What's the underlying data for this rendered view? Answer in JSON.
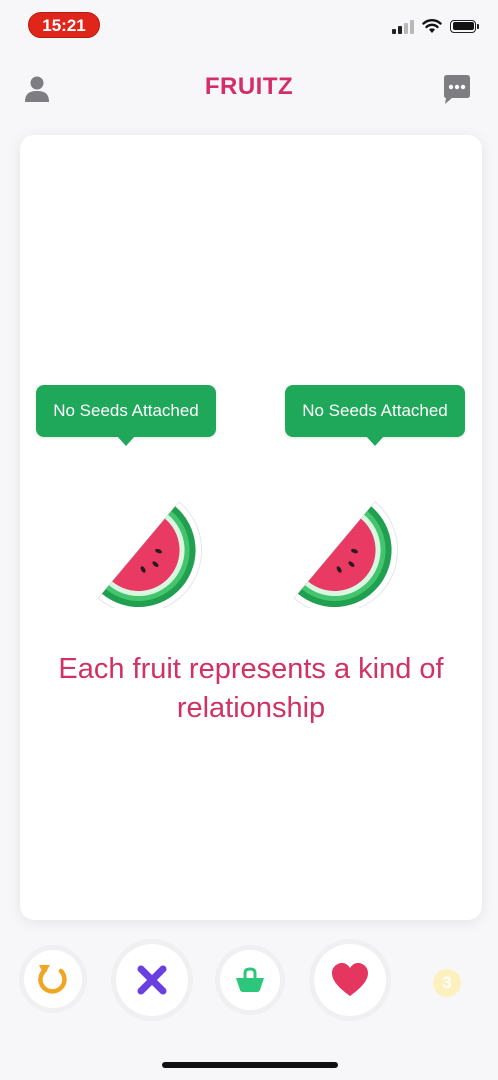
{
  "status_bar": {
    "time": "15:21"
  },
  "header": {
    "title": "FRUITZ"
  },
  "card": {
    "tooltip_left": "No Seeds Attached",
    "tooltip_right": "No Seeds Attached",
    "caption": "Each fruit represents a kind of relationship"
  },
  "actions": {
    "boost_count": "3"
  },
  "colors": {
    "brand": "#d42e6a",
    "tooltip_green": "#1fa85a",
    "nope_purple": "#6a3fe0",
    "basket_green": "#2cc77a",
    "like_pink": "#e4365f",
    "rewind_orange": "#f0a523",
    "status_red": "#e0261b"
  },
  "icons": {
    "profile": "profile-icon",
    "chat": "chat-icon",
    "rewind": "rewind-icon",
    "nope": "x-icon",
    "basket": "basket-icon",
    "like": "heart-icon",
    "boost": "boost-badge-icon",
    "fruit": "watermelon-icon"
  }
}
